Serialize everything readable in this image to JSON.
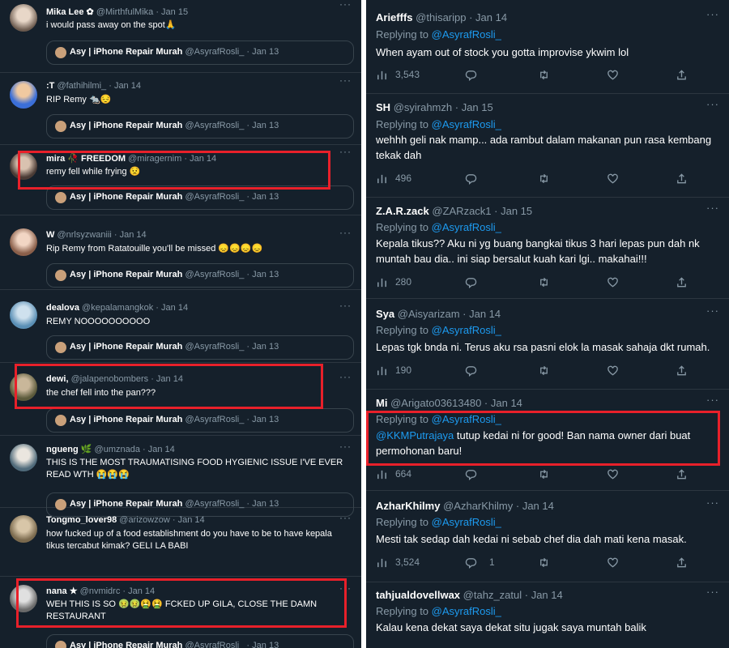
{
  "left_tweets": [
    {
      "name": "Mika Lee ✿",
      "handle": "@MirthfulMika",
      "date": "Jan 15",
      "text": "i would pass away on the spot🙏",
      "quote": {
        "name": "Asy | iPhone Repair Murah",
        "handle": "@AsyrafRosli_",
        "date": "Jan 13"
      }
    },
    {
      "name": ":T",
      "handle": "@fathihilmi_",
      "date": "Jan 14",
      "text": "RIP Remy 🐀😔",
      "quote": {
        "name": "Asy | iPhone Repair Murah",
        "handle": "@AsyrafRosli_",
        "date": "Jan 13"
      }
    },
    {
      "name": "mira 🥀 FREEDOM",
      "handle": "@miragernim",
      "date": "Jan 14",
      "text": "remy fell while frying 😟",
      "quote": {
        "name": "Asy | iPhone Repair Murah",
        "handle": "@AsyrafRosli_",
        "date": "Jan 13"
      }
    },
    {
      "name": "W",
      "handle": "@nrlsyzwaniii",
      "date": "Jan 14",
      "text": "Rip Remy from Ratatouille you'll be missed 😞😞😞😞",
      "quote": {
        "name": "Asy | iPhone Repair Murah",
        "handle": "@AsyrafRosli_",
        "date": "Jan 13"
      }
    },
    {
      "name": "dealova",
      "handle": "@kepalamangkok",
      "date": "Jan 14",
      "text": "REMY NOOOOOOOOOO",
      "quote": {
        "name": "Asy | iPhone Repair Murah",
        "handle": "@AsyrafRosli_",
        "date": "Jan 13"
      }
    },
    {
      "name": "dewi,",
      "handle": "@jalapenobombers",
      "date": "Jan 14",
      "text": "the chef fell into the pan???",
      "quote": {
        "name": "Asy | iPhone Repair Murah",
        "handle": "@AsyrafRosli_",
        "date": "Jan 13"
      }
    },
    {
      "name": "ngueng 🌿",
      "handle": "@umznada",
      "date": "Jan 14",
      "text": "THIS IS THE MOST TRAUMATISING FOOD HYGIENIC ISSUE I'VE EVER READ WTH 😭😭😭",
      "quote": {
        "name": "Asy | iPhone Repair Murah",
        "handle": "@AsyrafRosli_",
        "date": "Jan 13"
      }
    },
    {
      "name": "Tongmo_lover98",
      "handle": "@arizowzow",
      "date": "Jan 14",
      "text": "how fucked up of a food establishment do you have to be to have kepala tikus tercabut kimak? GELI LA BABI",
      "quote": null
    },
    {
      "name": "nana ★",
      "handle": "@nvmidrc",
      "date": "Jan 14",
      "text": "WEH THIS IS SO 🤢🤢🤮🤮 FCKED UP GILA, CLOSE THE DAMN RESTAURANT",
      "quote": {
        "name": "Asy | iPhone Repair Murah",
        "handle": "@AsyrafRosli_",
        "date": "Jan 13"
      }
    }
  ],
  "right_tweets": [
    {
      "name": "Ariefffs",
      "handle": "@thisaripp",
      "date": "Jan 14",
      "replying": "Replying to",
      "reply_to": "@AsyrafRosli_",
      "text": "When ayam out of stock you gotta improvise ykwim lol",
      "stats": "3,543",
      "replies": ""
    },
    {
      "name": "SH",
      "handle": "@syirahmzh",
      "date": "Jan 15",
      "replying": "Replying to",
      "reply_to": "@AsyrafRosli_",
      "text": "wehhh geli nak mamp... ada rambut dalam makanan pun rasa kembang tekak dah",
      "stats": "496",
      "replies": ""
    },
    {
      "name": "Z.A.R.zack",
      "handle": "@ZARzack1",
      "date": "Jan 15",
      "replying": "Replying to",
      "reply_to": "@AsyrafRosli_",
      "text": "Kepala tikus?? Aku ni yg buang bangkai tikus 3 hari lepas pun dah nk muntah bau dia.. ini siap bersalut kuah kari lgi.. makahai!!!",
      "stats": "280",
      "replies": ""
    },
    {
      "name": "Sya",
      "handle": "@Aisyarizam",
      "date": "Jan 14",
      "replying": "Replying to",
      "reply_to": "@AsyrafRosli_",
      "text": "Lepas tgk bnda ni. Terus aku rsa pasni elok la masak sahaja dkt rumah.",
      "stats": "190",
      "replies": ""
    },
    {
      "name": "Mi",
      "handle": "@Arigato03613480",
      "date": "Jan 14",
      "replying": "Replying to",
      "reply_to": "@AsyrafRosli_",
      "mention": "@KKMPutrajaya",
      "text": " tutup kedai ni for good! Ban nama owner dari buat permohonan baru!",
      "stats": "664",
      "replies": ""
    },
    {
      "name": "AzharKhilmy",
      "handle": "@AzharKhilmy",
      "date": "Jan 14",
      "replying": "Replying to",
      "reply_to": "@AsyrafRosli_",
      "text": "Mesti tak sedap dah kedai ni sebab chef dia dah mati kena masak.",
      "stats": "3,524",
      "replies": "1"
    },
    {
      "name": "tahjualdovellwax",
      "handle": "@tahz_zatul",
      "date": "Jan 14",
      "replying": "Replying to",
      "reply_to": "@AsyrafRosli_",
      "text": "Kalau kena dekat saya dekat situ jugak saya muntah balik",
      "stats": "",
      "replies": ""
    }
  ],
  "more_glyph": "···",
  "icons": [
    "more-icon",
    "stats-icon",
    "reply-icon",
    "retweet-icon",
    "like-icon",
    "share-icon"
  ],
  "colors": {
    "background": "#15202b",
    "accent": "#1d9bf0",
    "highlight": "#e8202a",
    "muted": "#8899a6"
  }
}
